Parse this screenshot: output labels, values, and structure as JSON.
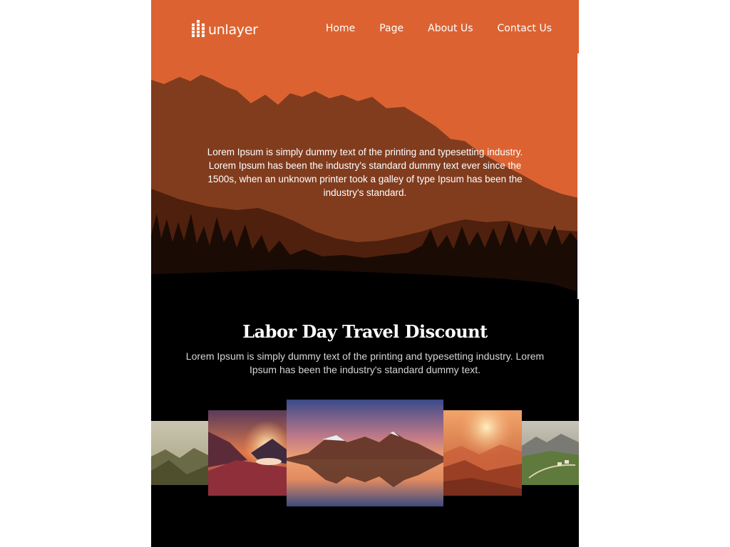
{
  "brand": {
    "name": "unlayer",
    "icon": "unlayer-logo-icon"
  },
  "nav": [
    {
      "label": "Home"
    },
    {
      "label": "Page"
    },
    {
      "label": "About Us"
    },
    {
      "label": "Contact Us"
    }
  ],
  "hero": {
    "text": "Lorem Ipsum is simply dummy text of the printing and typesetting industry. Lorem Ipsum has been the industry's standard dummy text ever since the 1500s, when an unknown printer took a galley of type Ipsum has been the industry's standard."
  },
  "promo": {
    "title": "Labor Day Travel Discount",
    "text": "Lorem Ipsum is simply dummy text of the printing and typesetting industry. Lorem Ipsum has been the industry's standard dummy text."
  },
  "gallery": [
    {
      "name": "green-mountain-ridge-photo"
    },
    {
      "name": "sunset-valley-photo"
    },
    {
      "name": "mountain-lake-reflection-photo"
    },
    {
      "name": "misty-orange-hills-photo"
    },
    {
      "name": "alpine-village-photo"
    }
  ],
  "colors": {
    "hero_bg": "#dc6331",
    "mountain_mid": "#813c1e",
    "dark_bg": "#000000"
  }
}
